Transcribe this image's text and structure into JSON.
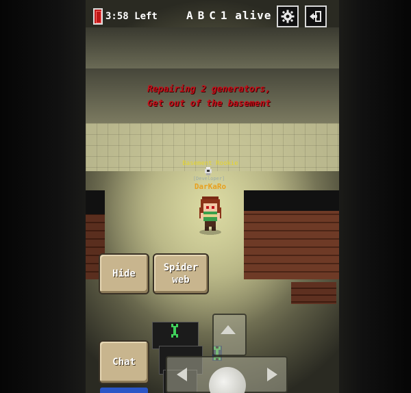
{
  "hud": {
    "timer_text": "3:58 Left",
    "players": [
      "A",
      "B",
      "C"
    ],
    "alive_text": "1 alive",
    "settings_icon": "gear-icon",
    "exit_icon": "exit-door-icon"
  },
  "objective": {
    "line1": "Repairing 2 generators,",
    "line2": "Get out of the basement"
  },
  "character": {
    "title_text": "Basement Rookie",
    "role_text": "[Developer]",
    "name": "DarKaRo"
  },
  "actions": {
    "hide_label": "Hide",
    "spider_web_label": "Spider\nweb",
    "chat_label": "Chat"
  },
  "colors": {
    "objective": "#c4101a",
    "player_name": "#e8a01e",
    "title": "#e6d62c",
    "button_bg": "#c8b58e",
    "wood": "#6e3a26"
  }
}
